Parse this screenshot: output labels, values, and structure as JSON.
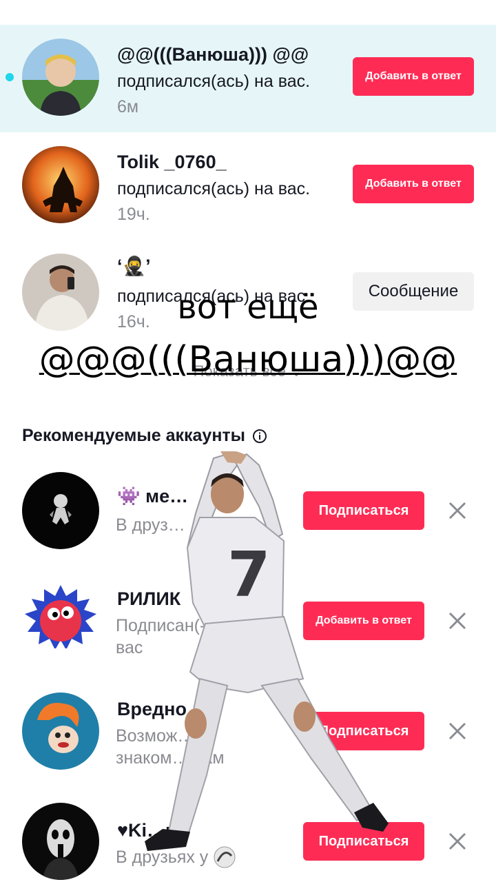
{
  "activity": [
    {
      "username": "@@(((Ванюша))) @@",
      "action": "подписался(ась) на вас.",
      "time": "6м",
      "button": "Добавить в ответ",
      "unread": true
    },
    {
      "username": "Tolik _0760_",
      "action": "подписался(ась) на вас.",
      "time": "19ч.",
      "button": "Добавить в ответ",
      "unread": false
    },
    {
      "username": "‘🥷’",
      "action": "подписался(ась) на вас.",
      "time": "16ч.",
      "button": "Сообщение",
      "unread": false
    }
  ],
  "show_all": "Показать все",
  "overlay": {
    "line1": "вот ещё",
    "line2": "@@@(((Ванюша)))@@"
  },
  "recommended": {
    "title": "Рекомендуемые аккаунты",
    "items": [
      {
        "username": "👾 ме…",
        "subtitle": "В друз…",
        "button": "Подписаться"
      },
      {
        "username": "РИЛИК",
        "subtitle": "Подписан(-…\nвас",
        "button": "Добавить в ответ"
      },
      {
        "username": "Вредно…",
        "subtitle": "Возмож…\nзнаком… вам",
        "button": "Подписаться"
      },
      {
        "username": "♥Ki…r♣",
        "subtitle": "В друзьях у",
        "button": "Подписаться"
      }
    ]
  },
  "colors": {
    "accent": "#fe2c55",
    "highlight_row": "#e6f6f8",
    "unread_dot": "#20d5ec",
    "secondary_text": "#8a8b91"
  }
}
